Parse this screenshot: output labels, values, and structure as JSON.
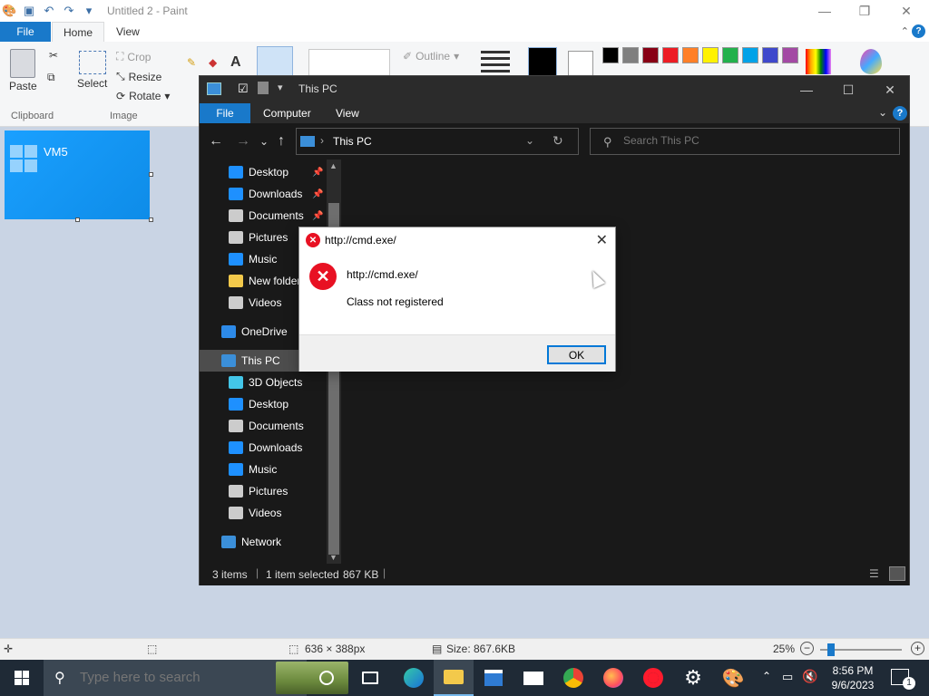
{
  "paint": {
    "title": "Untitled 2 - Paint",
    "tabs": {
      "file": "File",
      "home": "Home",
      "view": "View"
    },
    "ribbon": {
      "paste": "Paste",
      "clipboard": "Clipboard",
      "select": "Select",
      "crop": "Crop",
      "resize": "Resize",
      "rotate": "Rotate",
      "image": "Image",
      "outline": "Outline"
    },
    "canvas": {
      "image_label": "VM5"
    },
    "status": {
      "selection_size": "636 × 388px",
      "file_size": "Size: 867.6KB",
      "zoom": "25%"
    },
    "palette": [
      "#000000",
      "#7f7f7f",
      "#880015",
      "#ed1c24",
      "#ff7f27",
      "#fff200",
      "#22b14c",
      "#00a2e8",
      "#3f48cc",
      "#a349a4"
    ]
  },
  "explorer": {
    "title": "This PC",
    "tabs": {
      "file": "File",
      "computer": "Computer",
      "view": "View"
    },
    "help": "?",
    "address": "This PC",
    "search_placeholder": "Search This PC",
    "quick_access": [
      {
        "label": "Desktop",
        "pinned": true,
        "color": "#1e90ff"
      },
      {
        "label": "Downloads",
        "pinned": true,
        "color": "#1e90ff"
      },
      {
        "label": "Documents",
        "pinned": true,
        "color": "#cccccc"
      },
      {
        "label": "Pictures",
        "pinned": false,
        "color": "#cccccc"
      },
      {
        "label": "Music",
        "pinned": false,
        "color": "#1e90ff"
      },
      {
        "label": "New folder",
        "pinned": false,
        "color": "#f3c94b"
      },
      {
        "label": "Videos",
        "pinned": false,
        "color": "#cccccc"
      }
    ],
    "onedrive": "OneDrive",
    "this_pc": "This PC",
    "this_pc_items": [
      {
        "label": "3D Objects",
        "color": "#43c6e8"
      },
      {
        "label": "Desktop",
        "color": "#1e90ff"
      },
      {
        "label": "Documents",
        "color": "#cccccc"
      },
      {
        "label": "Downloads",
        "color": "#1e90ff"
      },
      {
        "label": "Music",
        "color": "#1e90ff"
      },
      {
        "label": "Pictures",
        "color": "#cccccc"
      },
      {
        "label": "Videos",
        "color": "#cccccc"
      }
    ],
    "network": "Network",
    "status": {
      "items": "3 items",
      "selected": "1 item selected",
      "size": "867 KB"
    }
  },
  "dialog": {
    "title": "http://cmd.exe/",
    "message_title": "http://cmd.exe/",
    "message": "Class not registered",
    "ok": "OK",
    "close": "✕"
  },
  "taskbar": {
    "search_placeholder": "Type here to search",
    "time": "8:56 PM",
    "date": "9/6/2023",
    "notification_count": "1"
  }
}
